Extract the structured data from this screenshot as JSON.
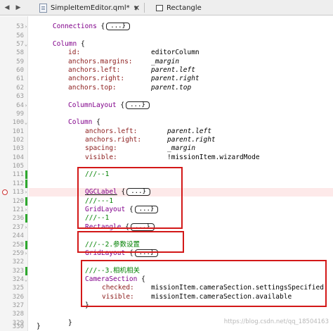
{
  "tabbar": {
    "file_tab": "SimpleItemEditor.qml*",
    "symbol_tab": "Rectangle",
    "close_glyph": "✕"
  },
  "colors": {
    "keyword": "#80008a",
    "property": "#8b1a1a",
    "comment": "#008000",
    "highlight_box": "#d31818"
  },
  "fold_placeholder": "...}",
  "lines": {
    "l53": {
      "num": "53",
      "type": "Connections",
      "brace": "{"
    },
    "l56": {
      "num": "56"
    },
    "l57": {
      "num": "57",
      "type": "Column",
      "brace": "{"
    },
    "l58": {
      "num": "58",
      "key": "id:",
      "value": "editorColumn"
    },
    "l59": {
      "num": "59",
      "key": "anchors.margins:",
      "value": "_margin"
    },
    "l60": {
      "num": "60",
      "key": "anchors.left:",
      "value": "parent.left"
    },
    "l61": {
      "num": "61",
      "key": "anchors.right:",
      "value": "parent.right"
    },
    "l62": {
      "num": "62",
      "key": "anchors.top:",
      "value": "parent.top"
    },
    "l63": {
      "num": "63"
    },
    "l64": {
      "num": "64",
      "type": "ColumnLayout",
      "brace": "{"
    },
    "l99": {
      "num": "99"
    },
    "l100": {
      "num": "100",
      "type": "Column",
      "brace": "{"
    },
    "l101": {
      "num": "101",
      "key": "anchors.left:",
      "value": "parent.left"
    },
    "l102": {
      "num": "102",
      "key": "anchors.right:",
      "value": "parent.right"
    },
    "l103": {
      "num": "103",
      "key": "spacing:",
      "value": "_margin"
    },
    "l104": {
      "num": "104",
      "key": "visible:",
      "value": "!missionItem.wizardMode"
    },
    "l105": {
      "num": "105"
    },
    "l111": {
      "num": "111",
      "comment": "///--1"
    },
    "l112": {
      "num": "112"
    },
    "l113": {
      "num": "113",
      "type": "QGCLabel",
      "brace": "{"
    },
    "l120": {
      "num": "120",
      "comment": "///---1"
    },
    "l121": {
      "num": "121",
      "type": "GridLayout",
      "brace": "{"
    },
    "l236": {
      "num": "236",
      "comment": "///--1"
    },
    "l237": {
      "num": "237",
      "type": "Rectangle",
      "brace": "{"
    },
    "l244": {
      "num": "244"
    },
    "l258": {
      "num": "258",
      "comment": "///--2.参数设置"
    },
    "l259": {
      "num": "259",
      "type": "GridLayout",
      "brace": "{"
    },
    "l322": {
      "num": "322"
    },
    "l323": {
      "num": "323",
      "comment": "///--3.相机相关"
    },
    "l324": {
      "num": "324",
      "type": "CameraSection",
      "brace": "{"
    },
    "l325": {
      "num": "325",
      "key": "checked:",
      "value": "missionItem.cameraSection.settingsSpecified"
    },
    "l326": {
      "num": "326",
      "key": "visible:",
      "value": "missionItem.cameraSection.available"
    },
    "l327": {
      "num": "327",
      "close": "}"
    },
    "l328": {
      "num": "328"
    },
    "l329": {
      "num": "329",
      "close": "}"
    },
    "l330": {
      "num": "330",
      "close": "}"
    }
  },
  "watermark": "https://blog.csdn.net/qq_18504163"
}
